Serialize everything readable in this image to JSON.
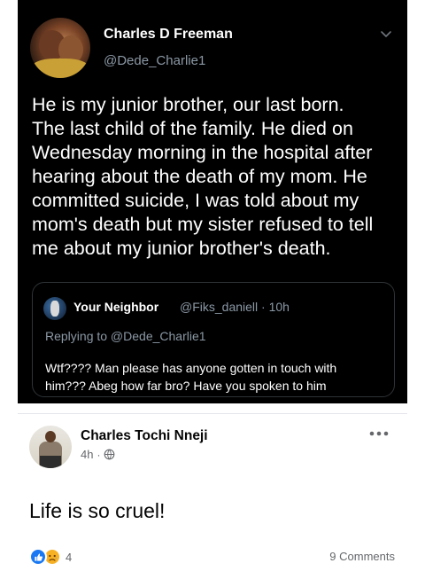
{
  "tweet": {
    "author_name": "Charles D Freeman",
    "author_handle": "@Dede_Charlie1",
    "text_lines": [
      "He is my junior brother, our last born.",
      "The last child of the family. He died on",
      "Wednesday morning in the hospital after",
      "hearing about the death of my mom. He",
      "committed suicide, I was told about my",
      "mom's death but my sister refused to tell",
      "me about my junior brother's death."
    ],
    "quoted": {
      "author_name": "Your Neighbor",
      "handle_time": "@Fiks_daniell · 10h",
      "replying_to": "Replying to @Dede_Charlie1",
      "text_lines": [
        "Wtf???? Man please has anyone gotten in touch with",
        "him??? Abeg how far bro? Have you spoken to him"
      ]
    }
  },
  "facebook_post": {
    "author_name": "Charles Tochi Nneji",
    "time": "4h",
    "separator": "·",
    "text": "Life is so cruel!",
    "reaction_count": "4",
    "comments_label": "9 Comments",
    "icons": {
      "privacy": "globe-icon",
      "more": "more-options-icon",
      "like": "like-reaction-icon",
      "sad": "sad-reaction-icon"
    }
  }
}
